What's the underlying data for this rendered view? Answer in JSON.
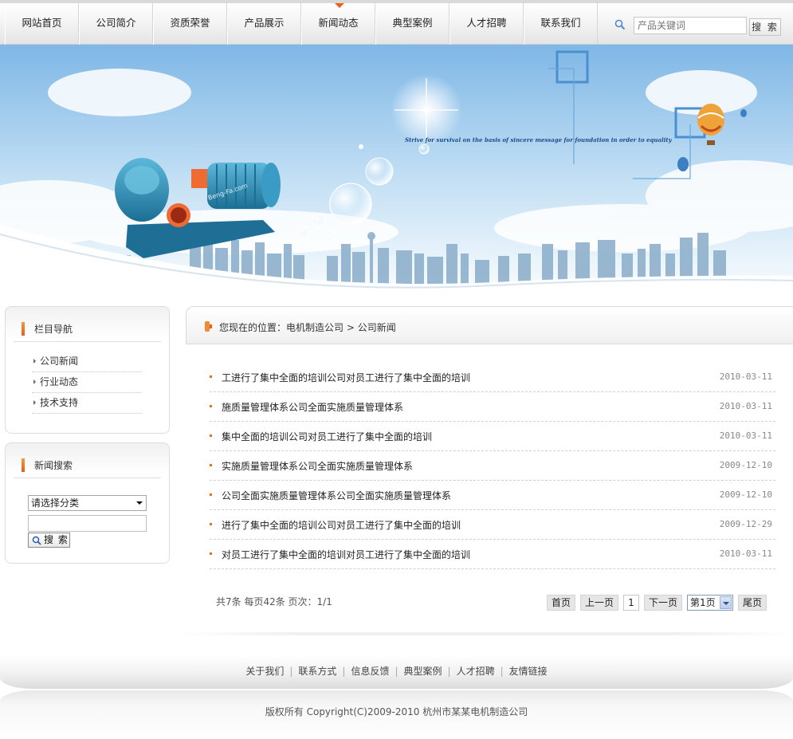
{
  "nav": {
    "items": [
      {
        "label": "网站首页",
        "active": false
      },
      {
        "label": "公司简介",
        "active": false
      },
      {
        "label": "资质荣誉",
        "active": false
      },
      {
        "label": "产品展示",
        "active": false
      },
      {
        "label": "新闻动态",
        "active": true
      },
      {
        "label": "典型案例",
        "active": false
      },
      {
        "label": "人才招聘",
        "active": false
      },
      {
        "label": "联系我们",
        "active": false
      }
    ],
    "search_placeholder": "产品关键词",
    "search_button": "搜 索"
  },
  "banner": {
    "slogan": "Strive for survival on the basis of sincere message for foundation in order to equality",
    "pump_watermark": "Beng-Fa.com"
  },
  "sidebar": {
    "nav_title": "栏目导航",
    "nav_items": [
      "公司新闻",
      "行业动态",
      "技术支持"
    ],
    "search_title": "新闻搜索",
    "category_select": "请选择分类",
    "search_button": "搜 索"
  },
  "main": {
    "location_label": "您现在的位置：",
    "breadcrumb_home": "电机制造公司",
    "breadcrumb_sep": " > ",
    "breadcrumb_current": "公司新闻",
    "news": [
      {
        "title": "工进行了集中全面的培训公司对员工进行了集中全面的培训",
        "date": "2010-03-11"
      },
      {
        "title": "施质量管理体系公司全面实施质量管理体系",
        "date": "2010-03-11"
      },
      {
        "title": "集中全面的培训公司对员工进行了集中全面的培训",
        "date": "2010-03-11"
      },
      {
        "title": "实施质量管理体系公司全面实施质量管理体系",
        "date": "2009-12-10"
      },
      {
        "title": "公司全面实施质量管理体系公司全面实施质量管理体系",
        "date": "2009-12-10"
      },
      {
        "title": "进行了集中全面的培训公司对员工进行了集中全面的培训",
        "date": "2009-12-29"
      },
      {
        "title": "对员工进行了集中全面的培训对员工进行了集中全面的培训",
        "date": "2010-03-11"
      }
    ],
    "pager": {
      "info": "共7条  每页42条  页次：1/1",
      "first": "首页",
      "prev": "上一页",
      "current": "1",
      "next": "下一页",
      "select": "第1页",
      "last": "尾页"
    }
  },
  "footer": {
    "links": [
      "关于我们",
      "联系方式",
      "信息反馈",
      "典型案例",
      "人才招聘",
      "友情链接"
    ],
    "copyright": "版权所有  Copyright(C)2009-2010 杭州市某某电机制造公司"
  },
  "colors": {
    "accent": "#e8621d",
    "sky": "#9cc8ea",
    "pump": "#2a8db5"
  }
}
